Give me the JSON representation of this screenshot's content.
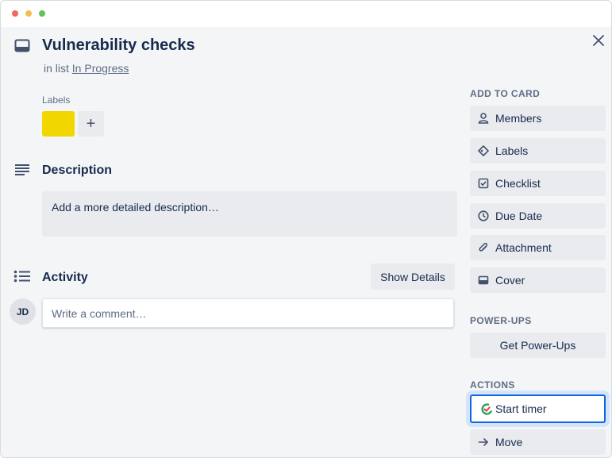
{
  "card": {
    "title": "Vulnerability checks",
    "in_list_prefix": "in list",
    "list_name": "In Progress"
  },
  "labels": {
    "heading": "Labels",
    "chips": [
      {
        "color": "#f2d600"
      }
    ],
    "add_symbol": "+"
  },
  "description": {
    "heading": "Description",
    "placeholder": "Add a more detailed description…"
  },
  "activity": {
    "heading": "Activity",
    "show_details_label": "Show Details",
    "avatar_initials": "JD",
    "comment_placeholder": "Write a comment…"
  },
  "sidebar": {
    "add_to_card_heading": "ADD TO CARD",
    "add_to_card": [
      {
        "label": "Members",
        "icon": "person-icon"
      },
      {
        "label": "Labels",
        "icon": "tag-icon"
      },
      {
        "label": "Checklist",
        "icon": "checkbox-icon"
      },
      {
        "label": "Due Date",
        "icon": "clock-icon"
      },
      {
        "label": "Attachment",
        "icon": "paperclip-icon"
      },
      {
        "label": "Cover",
        "icon": "cover-icon"
      }
    ],
    "power_ups_heading": "POWER-UPS",
    "power_ups_button": "Get Power-Ups",
    "actions_heading": "ACTIONS",
    "actions": [
      {
        "label": "Start timer",
        "icon": "timer-icon",
        "active": true
      },
      {
        "label": "Move",
        "icon": "arrow-right-icon",
        "active": false
      }
    ]
  },
  "colors": {
    "accent": "#0c66e4",
    "label_yellow": "#f2d600",
    "timer_green": "#26a65b",
    "timer_red": "#e2483d"
  }
}
